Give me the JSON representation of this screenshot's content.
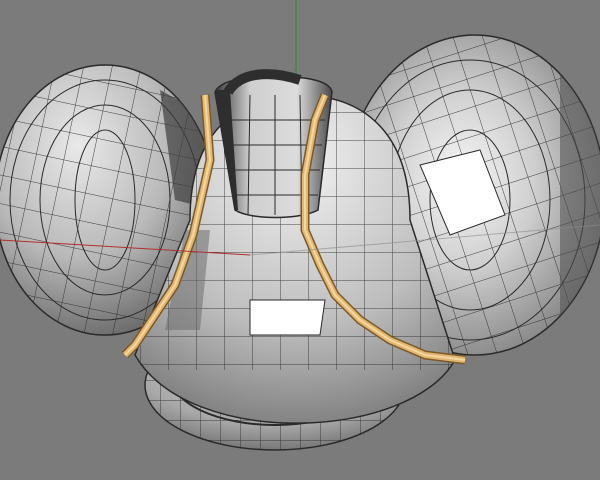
{
  "viewport": {
    "background_color": "#7b7b7b",
    "axis_x_color": "#b03030",
    "axis_y_color": "#2f8a2f",
    "mesh_base_color": "#a7a7a7",
    "mesh_light_color": "#e6e6e6",
    "mesh_shadow_color": "#3b3b3b",
    "wire_color": "#2a2a2a",
    "selection_edge_color": "#e2b66f",
    "selection_edge_highlight": "#f4d7a0"
  },
  "objects": [
    {
      "name": "left-lobe",
      "icon": "sphere-mesh"
    },
    {
      "name": "right-lobe",
      "icon": "sphere-mesh"
    },
    {
      "name": "center-body",
      "icon": "sphere-mesh"
    },
    {
      "name": "top-neck",
      "icon": "cylinder-mesh"
    },
    {
      "name": "bottom-socket",
      "icon": "ring-mesh"
    }
  ]
}
